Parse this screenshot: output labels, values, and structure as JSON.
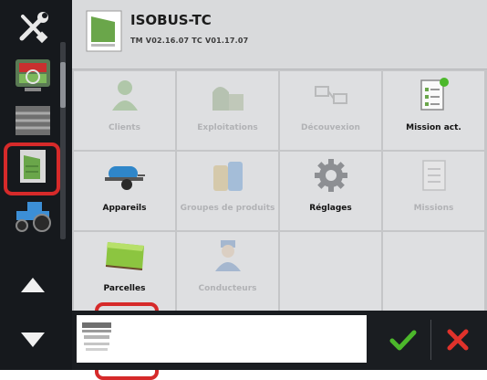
{
  "header": {
    "title": "ISOBUS-TC",
    "subtitle": "TM V02.16.07 TC V01.17.07"
  },
  "tiles": [
    {
      "label": "Clients",
      "icon": "client-icon",
      "enabled": false
    },
    {
      "label": "Exploitations",
      "icon": "farm-icon",
      "enabled": false
    },
    {
      "label": "Découvexion",
      "icon": "connection-icon",
      "enabled": false
    },
    {
      "label": "Mission act.",
      "icon": "active-mission-icon",
      "enabled": true
    },
    {
      "label": "Appareils",
      "icon": "sprayer-icon",
      "enabled": true
    },
    {
      "label": "Groupes de produits",
      "icon": "product-groups-icon",
      "enabled": false
    },
    {
      "label": "Réglages",
      "icon": "gear-icon",
      "enabled": true
    },
    {
      "label": "Missions",
      "icon": "missions-icon",
      "enabled": false
    },
    {
      "label": "Parcelles",
      "icon": "field-icon",
      "enabled": true,
      "highlighted": true
    },
    {
      "label": "Conducteurs",
      "icon": "driver-icon",
      "enabled": false
    }
  ],
  "sidebar": {
    "items": [
      {
        "icon": "wrench-screwdriver-icon"
      },
      {
        "icon": "tractor-terminal-icon"
      },
      {
        "icon": "implement-icon"
      },
      {
        "icon": "isobus-tc-icon",
        "highlighted": true
      },
      {
        "icon": "tractor-icon"
      }
    ],
    "nav": [
      "arrow-up-icon",
      "arrow-down-icon"
    ]
  },
  "bottom": {
    "confirm_icon": "checkmark-icon",
    "cancel_icon": "close-icon"
  },
  "colors": {
    "highlight": "#d62a2a",
    "confirm": "#4cb82b",
    "cancel": "#e0322b",
    "sidebar": "#16191d"
  }
}
